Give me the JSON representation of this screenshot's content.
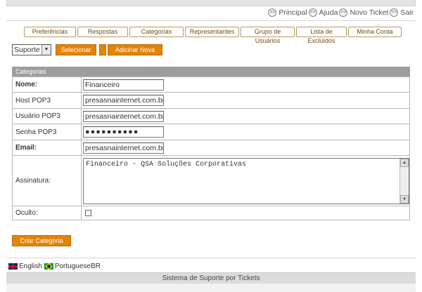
{
  "top_nav": [
    {
      "label": "Principal",
      "icon": "arrow-circle-icon"
    },
    {
      "label": "Ajuda",
      "icon": "arrow-circle-icon"
    },
    {
      "label": "Novo Ticket",
      "icon": "arrow-circle-icon"
    },
    {
      "label": "Sair",
      "icon": "arrow-circle-icon"
    }
  ],
  "tabs": [
    "Preferências",
    "Respostas",
    "Categorias",
    "Representantes",
    "Grupo de Usuários",
    "Lista de Excluídos",
    "Minha Conta"
  ],
  "select": {
    "value": "Suporte",
    "select_button": "Selecionar",
    "add_button": "Adicinar Nova"
  },
  "panel": {
    "title": "Categorias",
    "fields": {
      "name": {
        "label": "Nome:",
        "value": "Financeiro"
      },
      "host": {
        "label": "Host POP3",
        "value": "presasnainternet.com.br"
      },
      "user": {
        "label": "Usuário POP3",
        "value": "presasnainternet.com.br"
      },
      "pass": {
        "label": "Senha POP3",
        "value": "●●●●●●●●●●"
      },
      "email": {
        "label": "Email:",
        "value": "presasnainternet.com.br"
      },
      "signature": {
        "label": "Assinatura:",
        "value": "Financeiro - QSA Soluções Corporativas"
      },
      "hidden": {
        "label": "Oculto:",
        "checked": false
      }
    }
  },
  "create_button": "Criar Categoria",
  "languages": [
    {
      "label": "English",
      "icon": "uk-flag-icon"
    },
    {
      "label": "PortugueseBR",
      "icon": "brazil-flag-icon"
    }
  ],
  "footer": "Sistema de Suporte por Tickets",
  "colors": {
    "accent": "#e3840a",
    "panel_header": "#9d9d9d",
    "tab_border": "#b69960"
  }
}
